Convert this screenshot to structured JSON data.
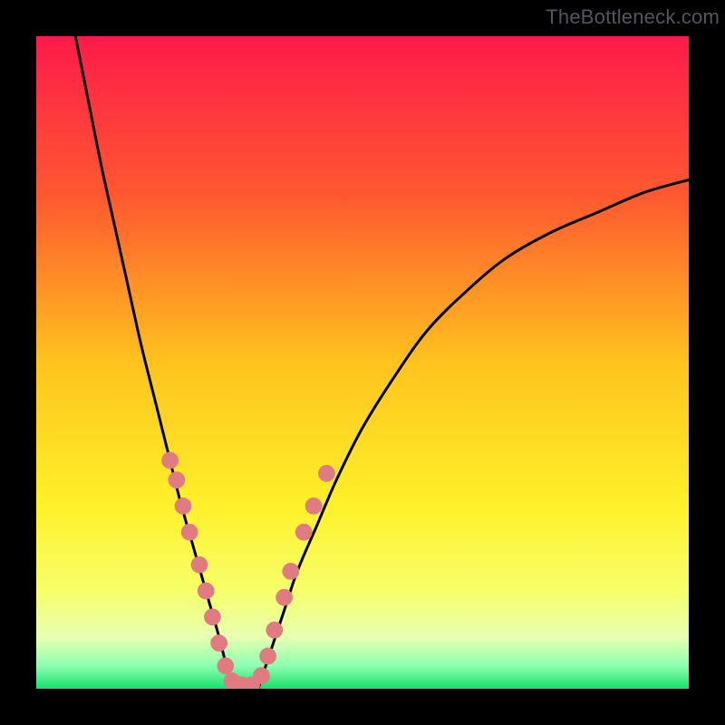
{
  "watermark": "TheBottleneck.com",
  "chart_data": {
    "type": "line",
    "title": "",
    "xlabel": "",
    "ylabel": "",
    "xlim": [
      0,
      100
    ],
    "ylim": [
      0,
      100
    ],
    "gradient_stops": [
      {
        "offset": 0.0,
        "color": "#ff1a4b"
      },
      {
        "offset": 0.25,
        "color": "#ff5a2f"
      },
      {
        "offset": 0.5,
        "color": "#ffc31e"
      },
      {
        "offset": 0.72,
        "color": "#fff12a"
      },
      {
        "offset": 0.85,
        "color": "#f6ff6a"
      },
      {
        "offset": 0.92,
        "color": "#e8ffb0"
      },
      {
        "offset": 0.965,
        "color": "#8dffb0"
      },
      {
        "offset": 1.0,
        "color": "#16e06a"
      }
    ],
    "series": [
      {
        "name": "left-branch",
        "x": [
          6,
          8,
          10,
          12,
          14,
          16,
          18,
          20,
          22,
          24,
          26,
          28,
          29,
          30
        ],
        "y": [
          100,
          90,
          80,
          71,
          62,
          53,
          45,
          37,
          29,
          22,
          15,
          8,
          4,
          0
        ]
      },
      {
        "name": "right-branch",
        "x": [
          34,
          36,
          38,
          40,
          43,
          46,
          50,
          55,
          60,
          66,
          72,
          79,
          86,
          93,
          100
        ],
        "y": [
          0,
          6,
          12,
          18,
          25,
          32,
          40,
          48,
          55,
          61,
          66,
          70,
          73,
          76,
          78
        ]
      }
    ],
    "valley_flat": {
      "x_from": 30,
      "x_to": 34,
      "y": 0
    },
    "markers": {
      "color": "#e07b82",
      "radius_pct": 1.3,
      "points": [
        {
          "x": 20.5,
          "y": 35
        },
        {
          "x": 21.5,
          "y": 32
        },
        {
          "x": 22.5,
          "y": 28
        },
        {
          "x": 23.5,
          "y": 24
        },
        {
          "x": 25.0,
          "y": 19
        },
        {
          "x": 26.0,
          "y": 15
        },
        {
          "x": 27.0,
          "y": 11
        },
        {
          "x": 28.0,
          "y": 7
        },
        {
          "x": 29.0,
          "y": 3.5
        },
        {
          "x": 30.0,
          "y": 1.2
        },
        {
          "x": 31.5,
          "y": 0.6
        },
        {
          "x": 33.0,
          "y": 0.6
        },
        {
          "x": 34.5,
          "y": 2.0
        },
        {
          "x": 35.5,
          "y": 5.0
        },
        {
          "x": 36.5,
          "y": 9.0
        },
        {
          "x": 38.0,
          "y": 14.0
        },
        {
          "x": 39.0,
          "y": 18.0
        },
        {
          "x": 41.0,
          "y": 24.0
        },
        {
          "x": 42.5,
          "y": 28.0
        },
        {
          "x": 44.5,
          "y": 33.0
        }
      ]
    }
  }
}
